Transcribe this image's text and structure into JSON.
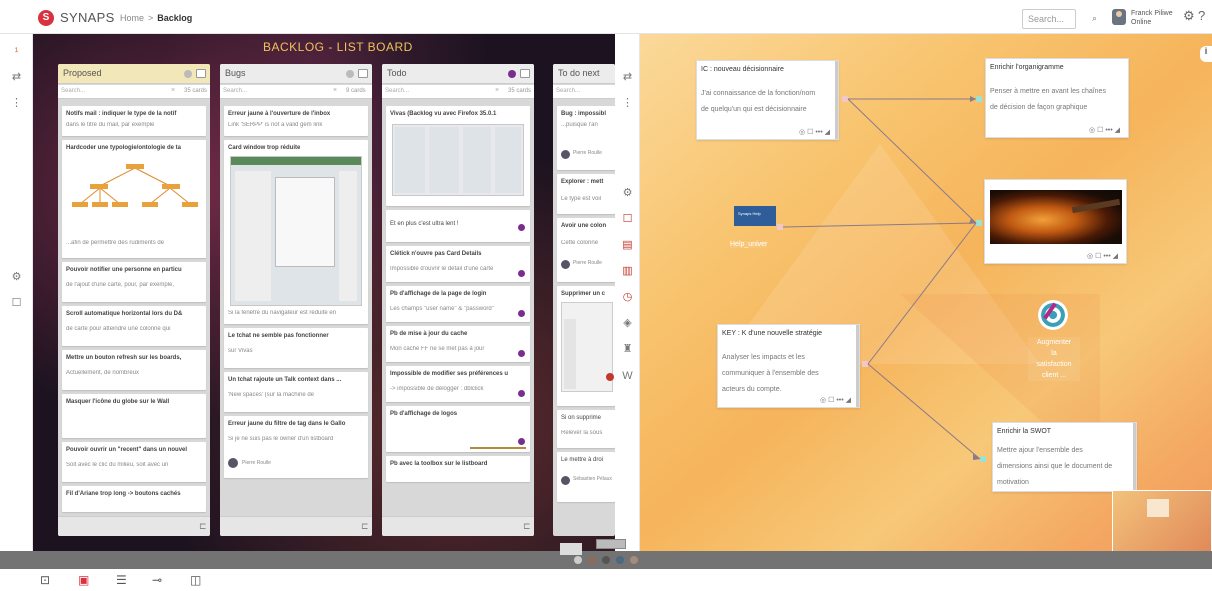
{
  "header": {
    "logo_text": "S",
    "brand": "SYNAPS",
    "breadcrumb": [
      "Home",
      "Backlog"
    ],
    "breadcrumb_sep": ">",
    "search_placeholder": "Search...",
    "user_name": "Franck Piliwe",
    "user_status": "Online"
  },
  "board": {
    "title": "BACKLOG - LIST BOARD",
    "columns": [
      {
        "title": "Proposed",
        "search": "Search...",
        "count": "35 cards",
        "cards": [
          {
            "title": "Notifs mail : indiquer le type de la notif",
            "desc": "dans le titre du mail, par exemple"
          },
          {
            "title": "Hardcoder une typologie/ontologie de ta",
            "desc": "...afin de permettre des rudiments de"
          },
          {
            "title": "Pouvoir notifier une personne en particu",
            "desc": "de l'ajout d'une carte, pour, par exemple,"
          },
          {
            "title": "Scroll automatique horizontal lors du D&",
            "desc": "de carte pour atteindre une colonne qui"
          },
          {
            "title": "Mettre un bouton refresh sur les boards,",
            "desc": "Actuellement, de nombreux"
          },
          {
            "title": "Masquer l'icône du globe sur le Wall",
            "desc": ""
          },
          {
            "title": "Pouvoir ouvrir un \"recent\" dans un nouvel",
            "desc": "Soit avec le clic du milieu, soit avec un"
          },
          {
            "title": "Fil d'Ariane trop long -> boutons cachés",
            "desc": ""
          }
        ]
      },
      {
        "title": "Bugs",
        "search": "Search...",
        "count": "9 cards",
        "cards": [
          {
            "title": "Erreur jaune à l'ouverture de l'inbox",
            "desc": "Link 'SERPP' is not a valid gem link"
          },
          {
            "title": "Card window trop réduite",
            "desc": ""
          },
          {
            "title": "Si la fenêtre du navigateur est réduite en",
            "desc": ""
          },
          {
            "title": "Le tchat ne semble pas fonctionner",
            "desc": "sur Vivas"
          },
          {
            "title": "Un tchat rajoute un Talk context dans ...",
            "desc": "'New spaces' (sur la machine de"
          },
          {
            "title": "Erreur jaune du filtre de tag dans le Gallo",
            "desc": "Si je ne suis pas le owner d'un listboard"
          }
        ],
        "assignee": "Pierre Roulle"
      },
      {
        "title": "Todo",
        "search": "Search...",
        "count": "35 cards",
        "cards": [
          {
            "title": "Vivas (Backlog vu avec Firefox 35.0.1",
            "desc": ""
          },
          {
            "title": "Et en plus c'est ultra lent !",
            "desc": ""
          },
          {
            "title": "Clétick n'ouvre pas Card Details",
            "desc": "Impossible d'ouvrir le détail d'une carte"
          },
          {
            "title": "Pb d'affichage de la page de login",
            "desc": "Les champs \"user name\" & \"password\""
          },
          {
            "title": "Pb de mise à jour du cache",
            "desc": "Mon cache FF ne se met pas à jour"
          },
          {
            "title": "Impossible de modifier ses préférences u",
            "desc": "-> impossible de délogger : dblclick"
          },
          {
            "title": "Pb d'affichage de logos",
            "desc": ""
          },
          {
            "title": "Pb avec la toolbox sur le listboard",
            "desc": ""
          }
        ]
      },
      {
        "title": "To do next",
        "search": "Search...",
        "count": "",
        "cards": [
          {
            "title": "Bug : impossibl",
            "desc": "...puisque l'an"
          },
          {
            "title": "Explorer : mett",
            "desc": "Le type est voil"
          },
          {
            "title": "Avoir une colon",
            "desc": "Cette colonne"
          },
          {
            "title": "Supprimer un c",
            "desc": ""
          },
          {
            "title": "Si on supprime",
            "desc": "Relever la sous"
          },
          {
            "title": "Le mettre à droi",
            "desc": ""
          }
        ],
        "assignees": [
          "Pierre Roulle",
          "Pierre Roulle",
          "Sébastien Pélaux"
        ]
      }
    ]
  },
  "mindmap": {
    "nodes": [
      {
        "id": "ic",
        "title": "IC : nouveau décisionnaire",
        "desc": [
          "J'ai connaissance de la fonction/nom",
          "de quelqu'un qui est décisionnaire"
        ]
      },
      {
        "id": "organi",
        "title": "Enrichir l'organigramme",
        "desc": [
          "Penser à mettre en avant les chaînes",
          "de décision de façon graphique"
        ]
      },
      {
        "id": "key",
        "title": "KEY : K d'une nouvelle stratégie",
        "desc": [
          "Analyser les impacts et les",
          "communiquer à l'ensemble des",
          "acteurs du compte."
        ]
      },
      {
        "id": "swot",
        "title": "Enrichir la SWOT",
        "desc": [
          "Mettre ajour l'ensemble des",
          "dimensions ainsi que le document de",
          "motivation"
        ]
      }
    ],
    "help_node_title": "Help_univer",
    "help_node_inner": "Synaps Help",
    "target_label": [
      "Augmenter",
      "la",
      "satisfaction",
      "client ..."
    ],
    "node_actions": "◎ ☐ ••• ◢"
  },
  "midrail_letter": "W",
  "colors": {
    "accent": "#d9323f",
    "purple_dot": "#7a2d8c",
    "board_title": "#f0c25b",
    "proposed_header": "#f2e7b8"
  }
}
